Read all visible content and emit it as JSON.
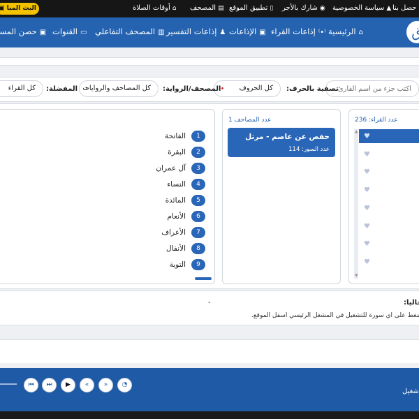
{
  "topbar": {
    "links": [
      {
        "label": "حصل بنا",
        "icon": "contact-icon"
      },
      {
        "label": "سياسة الخصوصية",
        "icon": "lock-icon"
      },
      {
        "label": "شارك بالأجر",
        "icon": "share-icon"
      },
      {
        "label": "تطبيق الموقع",
        "icon": "app-icon"
      },
      {
        "label": "المصحف",
        "icon": "mushaf-icon"
      },
      {
        "label": "أوقات الصلاة",
        "icon": "mosque-icon"
      }
    ],
    "live_label": "البث المبا"
  },
  "navbar": {
    "items": [
      {
        "label": "الرئيسية",
        "icon": "home-icon"
      },
      {
        "label": "إذاعات القراء",
        "icon": "broadcast-icon"
      },
      {
        "label": "الإذاعات",
        "icon": "radio-icon"
      },
      {
        "label": "إذاعات التفسير",
        "icon": "people-icon"
      },
      {
        "label": "المصحف التفاعلي",
        "icon": "book-icon"
      },
      {
        "label": "القنوات",
        "icon": "tv-icon"
      },
      {
        "label": "حصن المسا",
        "icon": "fortress-icon"
      }
    ]
  },
  "filters": {
    "search_placeholder": "اكتب جزء من اسم القارئ...",
    "letter_label": "تصفية بالحرف:",
    "letter_value": "كل الحروف",
    "mushaf_label": "المصحف/الرواية:",
    "mushaf_value": "كل المصاحف والروايات",
    "fav_label": "المفضلة:",
    "fav_value": "كل القراء"
  },
  "reciters_panel": {
    "title": "عدد القراء: 236"
  },
  "mushaf_panel": {
    "title": "عدد المصاحف 1",
    "card_title": "حفص عن عاصم - مرتل",
    "card_sub": "عدد السور: 114"
  },
  "surah_panel": {
    "items": [
      {
        "num": "1",
        "name": "الفاتحة"
      },
      {
        "num": "2",
        "name": "البقرة"
      },
      {
        "num": "3",
        "name": "آل عمران"
      },
      {
        "num": "4",
        "name": "النساء"
      },
      {
        "num": "5",
        "name": "المائدة"
      },
      {
        "num": "6",
        "name": "الأنعام"
      },
      {
        "num": "7",
        "name": "الأعراف"
      },
      {
        "num": "8",
        "name": "الأنفال"
      },
      {
        "num": "9",
        "name": "التوبة"
      }
    ]
  },
  "info": {
    "now_playing_label": "حاليا:",
    "instruction": "ثم اضغط على اي سورة للتشغيل في المشغل الرئيسي اسفل الموقع.",
    "dot": "-"
  },
  "player": {
    "status_label": "شغيل"
  }
}
